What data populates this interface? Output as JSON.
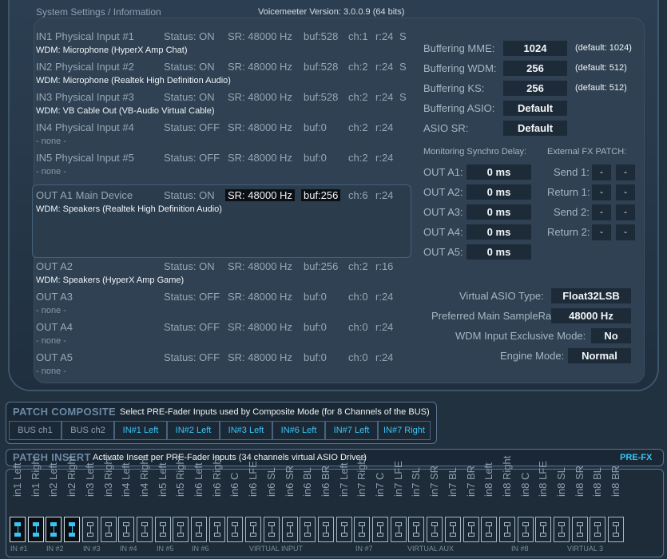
{
  "header": {
    "title": "System Settings / Information",
    "version": "Voicemeeter Version: 3.0.0.9 (64 bits)"
  },
  "devices": [
    {
      "name": "IN1 Physical Input #1",
      "status": "Status: ON",
      "sr": "SR: 48000 Hz",
      "buf": "buf:528",
      "ch": "ch:1",
      "r": "r:24",
      "extra": "S",
      "driver": "WDM: Microphone (HyperX Amp Chat)"
    },
    {
      "name": "IN2 Physical Input #2",
      "status": "Status: ON",
      "sr": "SR: 48000 Hz",
      "buf": "buf:528",
      "ch": "ch:2",
      "r": "r:24",
      "extra": "S",
      "driver": "WDM: Microphone (Realtek High Definition Audio)"
    },
    {
      "name": "IN3 Physical Input #3",
      "status": "Status: ON",
      "sr": "SR: 48000 Hz",
      "buf": "buf:528",
      "ch": "ch:2",
      "r": "r:24",
      "extra": "S",
      "driver": "WDM: VB Cable Out (VB-Audio Virtual Cable)"
    },
    {
      "name": "IN4 Physical Input #4",
      "status": "Status: OFF",
      "sr": "SR: 48000 Hz",
      "buf": "buf:0",
      "ch": "ch:2",
      "r": "r:24",
      "extra": "",
      "driver": "- none -"
    },
    {
      "name": "IN5 Physical Input #5",
      "status": "Status: OFF",
      "sr": "SR: 48000 Hz",
      "buf": "buf:0",
      "ch": "ch:2",
      "r": "r:24",
      "extra": "",
      "driver": "- none -"
    },
    {
      "name": "OUT A1 Main Device",
      "status": "Status: ON",
      "sr": "SR: 48000 Hz",
      "buf": "buf:256",
      "ch": "ch:6",
      "r": "r:24",
      "extra": "",
      "driver": "WDM: Speakers (Realtek High Definition Audio)"
    },
    {
      "name": "OUT A2",
      "status": "Status: ON",
      "sr": "SR: 48000 Hz",
      "buf": "buf:256",
      "ch": "ch:2",
      "r": "r:16",
      "extra": "",
      "driver": "WDM: Speakers (HyperX Amp Game)"
    },
    {
      "name": "OUT A3",
      "status": "Status: OFF",
      "sr": "SR: 48000 Hz",
      "buf": "buf:0",
      "ch": "ch:0",
      "r": "r:24",
      "extra": "",
      "driver": "- none -"
    },
    {
      "name": "OUT A4",
      "status": "Status: OFF",
      "sr": "SR: 48000 Hz",
      "buf": "buf:0",
      "ch": "ch:0",
      "r": "r:24",
      "extra": "",
      "driver": "- none -"
    },
    {
      "name": "OUT A5",
      "status": "Status: OFF",
      "sr": "SR: 48000 Hz",
      "buf": "buf:0",
      "ch": "ch:0",
      "r": "r:24",
      "extra": "",
      "driver": "- none -"
    }
  ],
  "buffering": [
    {
      "label": "Buffering MME:",
      "value": "1024",
      "default": "(default: 1024)"
    },
    {
      "label": "Buffering WDM:",
      "value": "256",
      "default": "(default: 512)"
    },
    {
      "label": "Buffering KS:",
      "value": "256",
      "default": "(default: 512)"
    },
    {
      "label": "Buffering ASIO:",
      "value": "Default",
      "default": ""
    },
    {
      "label": "ASIO SR:",
      "value": "Default",
      "default": ""
    }
  ],
  "sync": {
    "title": "Monitoring Synchro Delay:",
    "items": [
      {
        "label": "OUT A1:",
        "value": "0 ms"
      },
      {
        "label": "OUT A2:",
        "value": "0 ms"
      },
      {
        "label": "OUT A3:",
        "value": "0 ms"
      },
      {
        "label": "OUT A4:",
        "value": "0 ms"
      },
      {
        "label": "OUT A5:",
        "value": "0 ms"
      }
    ]
  },
  "fx": {
    "title": "External FX PATCH:",
    "items": [
      {
        "label": "Send 1:",
        "a": "-",
        "b": "-"
      },
      {
        "label": "Return 1:",
        "a": "-",
        "b": "-"
      },
      {
        "label": "Send 2:",
        "a": "-",
        "b": "-"
      },
      {
        "label": "Return 2:",
        "a": "-",
        "b": "-"
      }
    ]
  },
  "engine": [
    {
      "label": "Virtual ASIO Type:",
      "value": "Float32LSB"
    },
    {
      "label": "Preferred Main SampleRate:",
      "value": "48000 Hz"
    },
    {
      "label": "WDM Input Exclusive Mode:",
      "value": "No"
    },
    {
      "label": "Engine Mode:",
      "value": "Normal"
    }
  ],
  "composite": {
    "title": "PATCH COMPOSITE",
    "desc": "Select PRE-Fader Inputs used by Composite Mode (for 8 Channels of the BUS)",
    "buttons": [
      "BUS ch1",
      "BUS ch2",
      "IN#1 Left",
      "IN#2 Left",
      "IN#3 Left",
      "IN#6 Left",
      "IN#7 Left",
      "IN#7 Right"
    ]
  },
  "insert": {
    "title": "PATCH INSERT",
    "desc": "Activate Insert per PRE-Fader Inputs (34 channels virtual ASIO Driver)",
    "mode": "PRE-FX",
    "channels": [
      "in1 Left",
      "in1 Right",
      "in2 Left",
      "in2 Right",
      "in3 Left",
      "in3 Right",
      "in4 Left",
      "in4 Right",
      "in5 Left",
      "in5 Right",
      "in6 Left",
      "in6 Right",
      "in6 C",
      "in6 LFE",
      "in6 SL",
      "in6 SR",
      "in6 BL",
      "in6 BR",
      "in7 Left",
      "in7 Right",
      "in7 C",
      "in7 LFE",
      "in7 SL",
      "in7 SR",
      "in7 BL",
      "in7 BR",
      "in8 Left",
      "in8 Right",
      "in8 C",
      "in8 LFE",
      "in8 SL",
      "in8 SR",
      "in8 BL",
      "in8 BR"
    ],
    "active": [
      true,
      true,
      true,
      true,
      false,
      false,
      false,
      false,
      false,
      false,
      false,
      false,
      false,
      false,
      false,
      false,
      false,
      false,
      false,
      false,
      false,
      false,
      false,
      false,
      false,
      false,
      false,
      false,
      false,
      false,
      false,
      false,
      false,
      false
    ],
    "groups": [
      "IN #1",
      "IN #2",
      "IN #3",
      "IN #4",
      "IN #5",
      "IN #6",
      "VIRTUAL INPUT",
      "IN #7",
      "VIRTUAL AUX",
      "IN #8",
      "VIRTUAL 3"
    ]
  },
  "colors": {
    "accent": "#39c4f4",
    "panel": "#2f4152",
    "value_bg": "#1d2b38"
  }
}
